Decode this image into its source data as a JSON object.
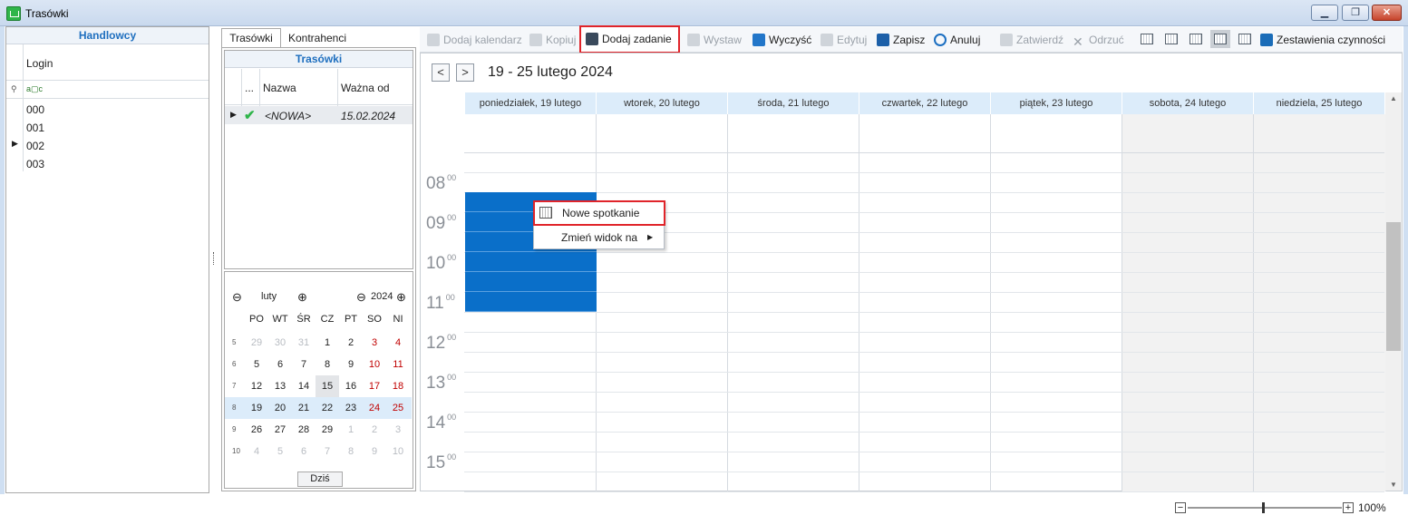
{
  "window": {
    "title": "Trasówki",
    "controls": {
      "minimize": "▁",
      "restore": "❐",
      "close": "✕"
    }
  },
  "left_panel": {
    "header": "Handlowcy",
    "column": "Login",
    "filter_icon_text": "a▢c",
    "rows": [
      "000",
      "001",
      "002",
      "003"
    ]
  },
  "middle_panel": {
    "tabs": [
      "Trasówki",
      "Kontrahenci"
    ],
    "header": "Trasówki",
    "columns": {
      "dots": "...",
      "name": "Nazwa",
      "valid": "Ważna od"
    },
    "rows": [
      {
        "name": "<NOWA>",
        "valid": "15.02.2024"
      }
    ]
  },
  "mini_calendar": {
    "month": "luty",
    "year": "2024",
    "weekdays": [
      "PO",
      "WT",
      "ŚR",
      "CZ",
      "PT",
      "SO",
      "NI"
    ],
    "weeks": [
      {
        "num": "5",
        "days": [
          "29",
          "30",
          "31",
          "1",
          "2",
          "3",
          "4"
        ]
      },
      {
        "num": "6",
        "days": [
          "5",
          "6",
          "7",
          "8",
          "9",
          "10",
          "11"
        ]
      },
      {
        "num": "7",
        "days": [
          "12",
          "13",
          "14",
          "15",
          "16",
          "17",
          "18"
        ]
      },
      {
        "num": "8",
        "days": [
          "19",
          "20",
          "21",
          "22",
          "23",
          "24",
          "25"
        ]
      },
      {
        "num": "9",
        "days": [
          "26",
          "27",
          "28",
          "29",
          "1",
          "2",
          "3"
        ]
      },
      {
        "num": "10",
        "days": [
          "4",
          "5",
          "6",
          "7",
          "8",
          "9",
          "10"
        ]
      }
    ],
    "today_button": "Dziś"
  },
  "toolbar": {
    "add_calendar": "Dodaj kalendarz",
    "copy": "Kopiuj",
    "add_task": "Dodaj zadanie",
    "issue": "Wystaw",
    "clear": "Wyczyść",
    "edit": "Edytuj",
    "save": "Zapisz",
    "cancel": "Anuluj",
    "approve": "Zatwierdź",
    "reject": "Odrzuć",
    "summary": "Zestawienia czynności"
  },
  "scheduler": {
    "range": "19 - 25 lutego 2024",
    "prev": "<",
    "next": ">",
    "days": [
      "poniedziałek, 19 lutego",
      "wtorek, 20 lutego",
      "środa, 21 lutego",
      "czwartek, 22 lutego",
      "piątek, 23 lutego",
      "sobota, 24 lutego",
      "niedziela, 25 lutego"
    ],
    "hours": [
      "08",
      "09",
      "10",
      "11",
      "12",
      "13",
      "14",
      "15"
    ],
    "minutes": "00"
  },
  "context_menu": {
    "new_meeting": "Nowe spotkanie",
    "change_view": "Zmień widok na"
  },
  "status": {
    "zoom": "100%",
    "minus": "−",
    "plus": "+"
  },
  "colors": {
    "accent": "#1f6fbf",
    "event": "#0a6fc9",
    "highlight": "#e0242a",
    "weekend_red": "#c00000"
  }
}
